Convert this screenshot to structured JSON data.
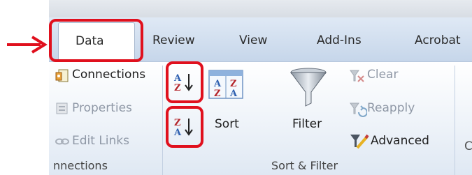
{
  "tabs": {
    "data": "Data",
    "review": "Review",
    "view": "View",
    "addins": "Add-Ins",
    "acrobat": "Acrobat"
  },
  "connections_group": {
    "connections": "Connections",
    "properties": "Properties",
    "edit_links": "Edit Links",
    "group_label": "nnections"
  },
  "sort_filter_group": {
    "sort": "Sort",
    "filter": "Filter",
    "clear": "Clear",
    "reapply": "Reapply",
    "advanced": "Advanced",
    "group_label": "Sort & Filter"
  },
  "icons": {
    "sort_asc": "sort-ascending-icon",
    "sort_desc": "sort-descending-icon",
    "sort": "sort-dialog-icon",
    "filter": "funnel-icon"
  },
  "colors": {
    "highlight": "#e0101d",
    "ribbon_tab": "#c6d6ea"
  }
}
